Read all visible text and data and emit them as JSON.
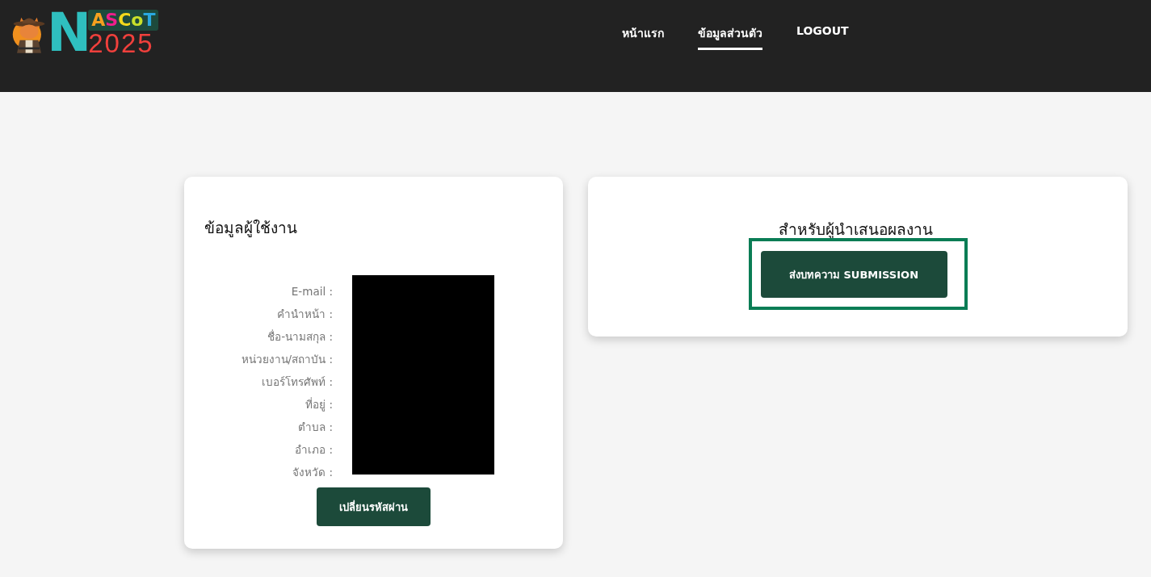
{
  "logo": {
    "initial": "N",
    "letters": [
      {
        "char": "A",
        "color": "#f5a01f"
      },
      {
        "char": "S",
        "color": "#ee1f8c"
      },
      {
        "char": "C",
        "color": "#f2d81c"
      },
      {
        "char": "o",
        "color": "#c8e02a"
      },
      {
        "char": "T",
        "color": "#2aa8e0"
      }
    ],
    "year": "2025"
  },
  "nav": [
    {
      "label": "หน้าแรก",
      "selected": false
    },
    {
      "label": "ข้อมูลส่วนตัว",
      "selected": true
    },
    {
      "label": "LOGOUT",
      "selected": false
    }
  ],
  "profile": {
    "title": "ข้อมูลผู้ใช้งาน",
    "fields": [
      "E-mail :",
      "คำนำหน้า :",
      "ชื่อ-นามสกุล :",
      "หน่วยงาน/สถาบัน :",
      "เบอร์โทรศัพท์ :",
      "ที่อยู่ :",
      "ตำบล :",
      "อำเภอ :",
      "จังหวัด :"
    ],
    "button": "เปลี่ยนรหัสผ่าน"
  },
  "presenter": {
    "title": "สำหรับผู้นำเสนอผลงาน",
    "button": "ส่งบทความ SUBMISSION",
    "highlighted": true
  }
}
